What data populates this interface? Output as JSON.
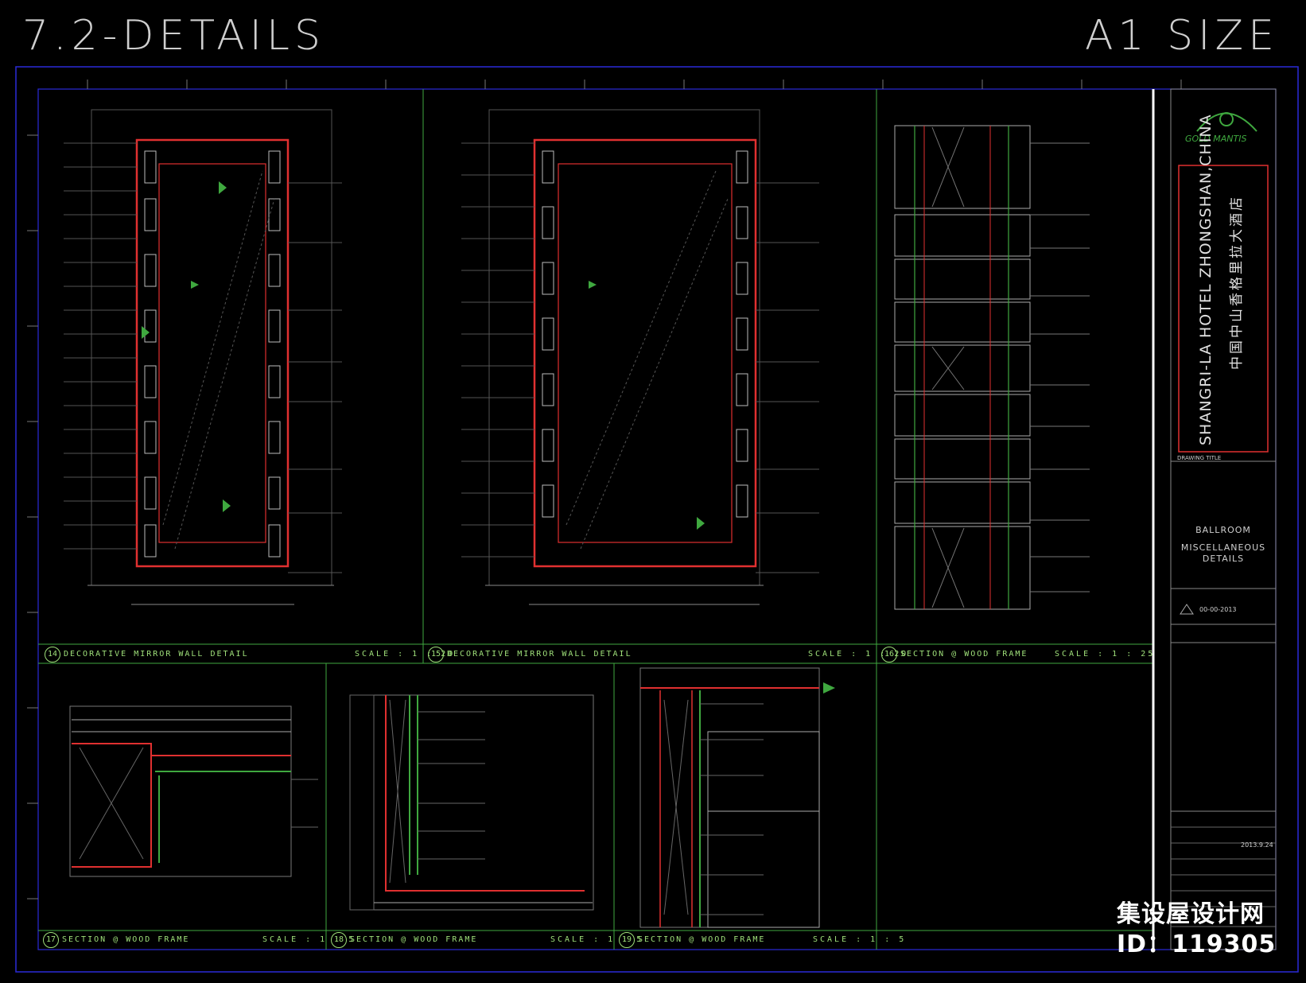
{
  "header": {
    "left_title": "7.2-DETAILS",
    "right_title": "A1 SIZE"
  },
  "panels": [
    {
      "num": "14",
      "title": "DECORATIVE MIRROR WALL DETAIL",
      "scale": "SCALE : 1 : 20"
    },
    {
      "num": "15",
      "title": "DECORATIVE MIRROR WALL DETAIL",
      "scale": "SCALE : 1 : 20"
    },
    {
      "num": "16",
      "title": "SECTION @ WOOD FRAME",
      "scale": "SCALE : 1 : 25"
    },
    {
      "num": "17",
      "title": "SECTION @ WOOD FRAME",
      "scale": "SCALE : 1 : 5"
    },
    {
      "num": "18",
      "title": "SECTION @ WOOD FRAME",
      "scale": "SCALE : 1 : 5"
    },
    {
      "num": "19",
      "title": "SECTION @ WOOD FRAME",
      "scale": "SCALE : 1 : 5"
    }
  ],
  "title_block": {
    "logo_text": "GOLD MANTIS",
    "project_en": "SHANGRI-LA HOTEL ZHONGSHAN,CHINA",
    "project_cn": "中国中山香格里拉大酒店",
    "drawing_title_label": "DRAWING TITLE",
    "area": "BALLROOM",
    "drawing_title_line1": "MISCELLANEOUS",
    "drawing_title_line2": "DETAILS",
    "revision_date": "00-00-2013",
    "date": "2013.9.24"
  },
  "watermark": {
    "name": "集设屋设计网",
    "id": "ID：119305"
  },
  "colors": {
    "frame": "#2a2ad8",
    "panel": "#3fa83f",
    "wall": "#e03030",
    "line": "#c8c8c8",
    "text": "#9fe07a"
  }
}
